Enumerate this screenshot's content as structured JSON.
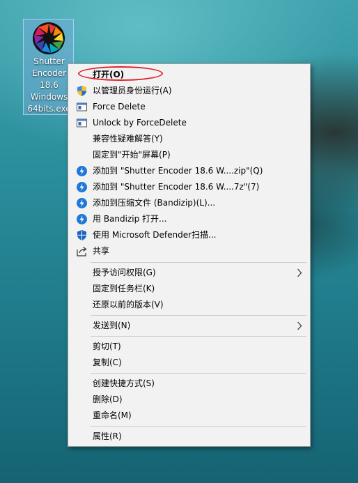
{
  "desktop": {
    "icon_label": "Shutter\nEncoder\n18.6\nWindows\n64bits.exe"
  },
  "menu": {
    "items": [
      {
        "label": "打开(O)",
        "icon": "none",
        "default": true
      },
      {
        "label": "以管理员身份运行(A)",
        "icon": "uac-shield-icon"
      },
      {
        "label": "Force Delete",
        "icon": "window-app-icon"
      },
      {
        "label": "Unlock by ForceDelete",
        "icon": "window-app-icon"
      },
      {
        "label": "兼容性疑难解答(Y)",
        "icon": "none"
      },
      {
        "label": "固定到\"开始\"屏幕(P)",
        "icon": "none"
      },
      {
        "label": "添加到 \"Shutter Encoder 18.6 W....zip\"(Q)",
        "icon": "bandizip-icon"
      },
      {
        "label": "添加到 \"Shutter Encoder 18.6 W....7z\"(7)",
        "icon": "bandizip-icon"
      },
      {
        "label": "添加到压缩文件 (Bandizip)(L)...",
        "icon": "bandizip-icon"
      },
      {
        "label": "用 Bandizip 打开...",
        "icon": "bandizip-icon"
      },
      {
        "label": "使用 Microsoft Defender扫描...",
        "icon": "defender-shield-icon"
      },
      {
        "label": "共享",
        "icon": "share-icon"
      },
      {
        "label": "授予访问权限(G)",
        "icon": "none",
        "submenu": true
      },
      {
        "label": "固定到任务栏(K)",
        "icon": "none"
      },
      {
        "label": "还原以前的版本(V)",
        "icon": "none"
      },
      {
        "label": "发送到(N)",
        "icon": "none",
        "submenu": true
      },
      {
        "label": "剪切(T)",
        "icon": "none"
      },
      {
        "label": "复制(C)",
        "icon": "none"
      },
      {
        "label": "创建快捷方式(S)",
        "icon": "none"
      },
      {
        "label": "删除(D)",
        "icon": "none"
      },
      {
        "label": "重命名(M)",
        "icon": "none"
      },
      {
        "label": "属性(R)",
        "icon": "none"
      }
    ]
  },
  "colors": {
    "menu_background": "#f2f2f2",
    "annotation": "#e0202a",
    "bandizip_blue": "#1e78d7"
  }
}
